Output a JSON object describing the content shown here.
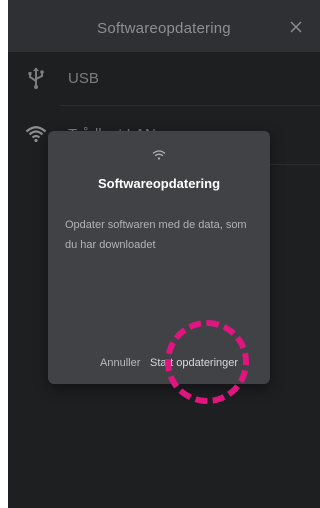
{
  "header": {
    "title": "Softwareopdatering",
    "close_icon": "close-icon"
  },
  "list": {
    "items": [
      {
        "icon": "usb-icon",
        "label": "USB"
      },
      {
        "icon": "wifi-icon",
        "label": "Trådløst LAN"
      }
    ]
  },
  "dialog": {
    "icon": "wifi-icon",
    "title": "Softwareopdatering",
    "body": "Opdater softwaren med de data, som du har downloadet",
    "cancel_label": "Annuller",
    "confirm_label": "Start opdateringer"
  },
  "annotation": {
    "color": "#e0157f",
    "shape": "dashed-circle"
  }
}
